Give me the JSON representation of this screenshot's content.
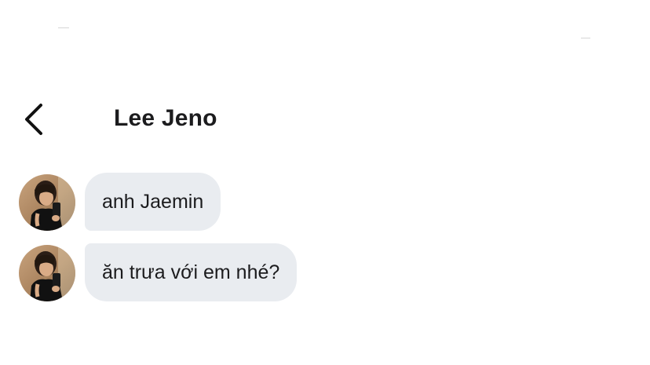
{
  "header": {
    "back_icon": "chevron-left-icon",
    "title": "Lee Jeno"
  },
  "conversation": {
    "messages": [
      {
        "text": "anh Jaemin",
        "avatar": "avatar"
      },
      {
        "text": "ăn trưa với em nhé?",
        "avatar": "avatar"
      }
    ]
  },
  "colors": {
    "background": "#ffffff",
    "bubble": "#e9ecf0",
    "text": "#1c1c1e"
  }
}
